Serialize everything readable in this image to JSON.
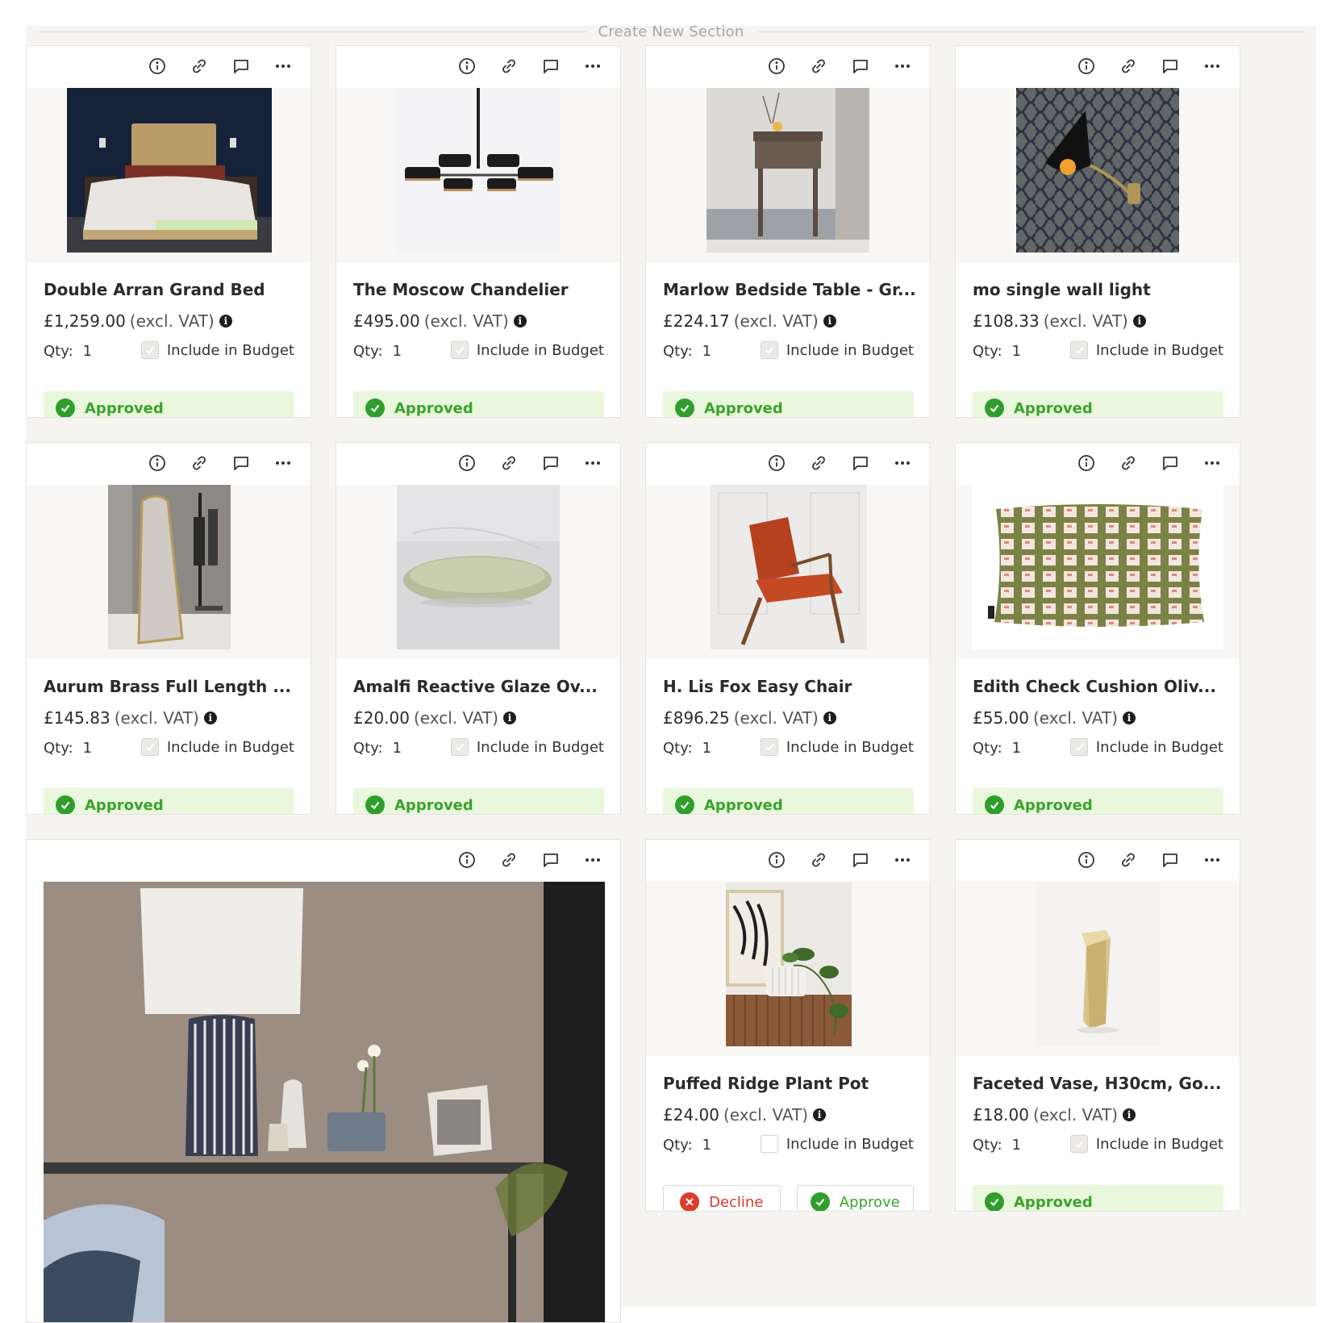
{
  "section_header": {
    "label": "Create New Section"
  },
  "common": {
    "excl_vat": "(excl. VAT)",
    "qty_label": "Qty:",
    "include_budget_label": "Include in Budget",
    "approved_label": "Approved",
    "decline_label": "Decline",
    "approve_label": "Approve",
    "info_glyph": "i"
  },
  "colors": {
    "board_bg": "#f6f4f1",
    "approved_bg": "#e9f8dd",
    "approved_text": "#3aa32c",
    "decline_red": "#df3b2b"
  },
  "toolbar_icons": [
    "info-icon",
    "link-icon",
    "comment-icon",
    "more-icon"
  ],
  "products": [
    {
      "title": "Double Arran Grand Bed",
      "price": "£1,259.00",
      "qty": "1",
      "include_in_budget": true,
      "status": "approved"
    },
    {
      "title": "The Moscow Chandelier",
      "price": "£495.00",
      "qty": "1",
      "include_in_budget": true,
      "status": "approved"
    },
    {
      "title": "Marlow Bedside Table - Gr...",
      "price": "£224.17",
      "qty": "1",
      "include_in_budget": true,
      "status": "approved"
    },
    {
      "title": "mo single wall light",
      "price": "£108.33",
      "qty": "1",
      "include_in_budget": true,
      "status": "approved"
    },
    {
      "title": "Aurum Brass Full Length ...",
      "price": "£145.83",
      "qty": "1",
      "include_in_budget": true,
      "status": "approved"
    },
    {
      "title": "Amalfi Reactive Glaze Ov...",
      "price": "£20.00",
      "qty": "1",
      "include_in_budget": true,
      "status": "approved"
    },
    {
      "title": "H. Lis Fox Easy Chair",
      "price": "£896.25",
      "qty": "1",
      "include_in_budget": true,
      "status": "approved"
    },
    {
      "title": "Edith Check Cushion Oliv...",
      "price": "£55.00",
      "qty": "1",
      "include_in_budget": true,
      "status": "approved"
    },
    {
      "title": "Puffed Ridge Plant Pot",
      "price": "£24.00",
      "qty": "1",
      "include_in_budget": false,
      "status": "pending"
    },
    {
      "title": "Faceted Vase, H30cm, Go...",
      "price": "£18.00",
      "qty": "1",
      "include_in_budget": true,
      "status": "approved"
    }
  ],
  "image_card": {
    "image": "lamp-scene-image"
  }
}
